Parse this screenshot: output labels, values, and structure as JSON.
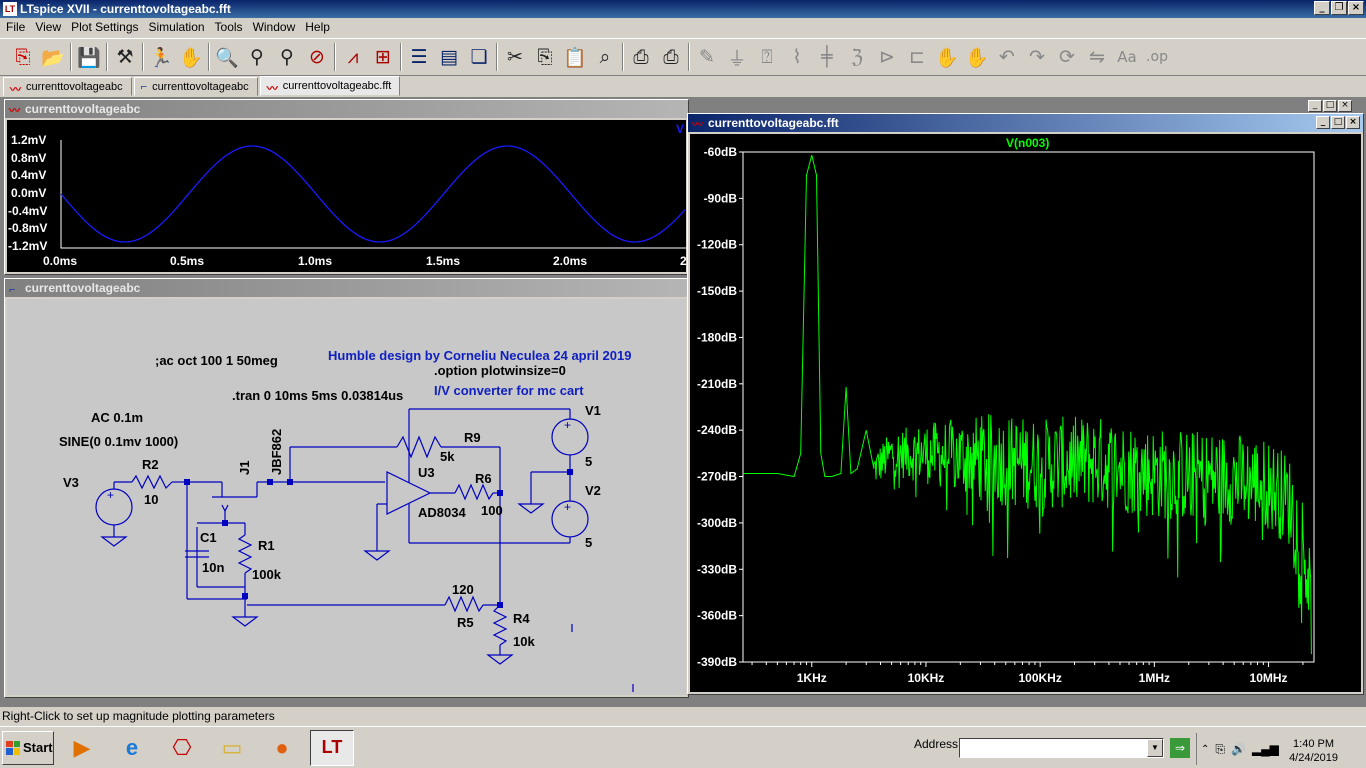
{
  "app": {
    "title": "LTspice XVII - currenttovoltageabc.fft"
  },
  "menu": [
    "File",
    "View",
    "Plot Settings",
    "Simulation",
    "Tools",
    "Window",
    "Help"
  ],
  "toolbar": {
    "icons": [
      "new-schematic-icon",
      "open-icon",
      "save-icon",
      "control-panel-icon",
      "run-icon",
      "halt-icon",
      "zoom-in-icon",
      "zoom-out-icon",
      "zoom-fit-icon",
      "cancel-zoom-icon",
      "autorange-icon",
      "grid-icon",
      "tile-horizontal-icon",
      "tile-vertical-icon",
      "cascade-icon",
      "cut-icon",
      "copy-icon",
      "paste-icon",
      "find-icon",
      "print-icon",
      "print-setup-icon",
      "wire-icon",
      "ground-icon",
      "label-icon",
      "resistor-icon",
      "capacitor-icon",
      "inductor-icon",
      "diode-icon",
      "component-icon",
      "move-icon",
      "drag-icon",
      "undo-icon",
      "redo-icon",
      "rotate-icon",
      "mirror-icon",
      "text-icon",
      "spice-directive-icon"
    ]
  },
  "tabs": [
    {
      "label": "currenttovoltageabc",
      "icon": "waveform-icon"
    },
    {
      "label": "currenttovoltageabc",
      "icon": "schematic-icon"
    },
    {
      "label": "currenttovoltageabc.fft",
      "icon": "waveform-icon"
    }
  ],
  "waveform_window": {
    "title": "currenttovoltageabc",
    "trace_label_partial": "V",
    "y_ticks": [
      "1.2mV",
      "0.8mV",
      "0.4mV",
      "0.0mV",
      "-0.4mV",
      "-0.8mV",
      "-1.2mV"
    ],
    "x_ticks": [
      "0.0ms",
      "0.5ms",
      "1.0ms",
      "1.5ms",
      "2.0ms",
      "2"
    ]
  },
  "schematic_window": {
    "title": "currenttovoltageabc",
    "texts": {
      "ac_directive": ";ac oct 100 1 50meg",
      "credit": "Humble design by Corneliu Neculea 24 april 2019",
      "option": ".option plotwinsize=0",
      "tran": ".tran 0 10ms 5ms 0.03814us",
      "subtitle": "I/V converter for mc cart",
      "ac_value": "AC 0.1m",
      "sine": "SINE(0 0.1mv 1000)",
      "v3": "V3",
      "r2": "R2",
      "r2_val": "10",
      "j1": "J1",
      "jbf": "JBF862",
      "c1": "C1",
      "c1_val": "10n",
      "r1": "R1",
      "r1_val": "100k",
      "r9": "R9",
      "r9_val": "5k",
      "u3": "U3",
      "u3_part": "AD8034",
      "r6": "R6",
      "r6_val": "100",
      "v1": "V1",
      "v1_val": "5",
      "v2": "V2",
      "v2_val": "5",
      "r5_val": "120",
      "r5": "R5",
      "r4": "R4",
      "r4_val": "10k"
    }
  },
  "fft_window": {
    "title": "currenttovoltageabc.fft",
    "trace": "V(n003)",
    "trace_color": "#00ff00"
  },
  "chart_data": {
    "type": "line",
    "title": "V(n003)",
    "xscale": "log",
    "x_ticks": [
      "1KHz",
      "10KHz",
      "100KHz",
      "1MHz",
      "10MHz"
    ],
    "y_ticks": [
      "-60dB",
      "-90dB",
      "-120dB",
      "-150dB",
      "-180dB",
      "-210dB",
      "-240dB",
      "-270dB",
      "-300dB",
      "-330dB",
      "-360dB",
      "-390dB"
    ],
    "xlim": [
      250,
      25000000
    ],
    "ylim": [
      -390,
      -60
    ],
    "grid": false,
    "series": [
      {
        "name": "V(n003)",
        "color": "#00ff00",
        "x": [
          250,
          500,
          700,
          800,
          900,
          1000,
          1100,
          1200,
          1300,
          1500,
          1800,
          2000,
          2200,
          2500,
          3000,
          3500,
          5000,
          10000,
          30000,
          100000,
          300000,
          1000000,
          3000000,
          6000000,
          10000000,
          15000000,
          20000000,
          24000000
        ],
        "y": [
          -268,
          -268,
          -270,
          -255,
          -75,
          -62,
          -75,
          -255,
          -270,
          -270,
          -268,
          -212,
          -268,
          -265,
          -240,
          -265,
          -255,
          -255,
          -258,
          -262,
          -260,
          -268,
          -270,
          -272,
          -275,
          -285,
          -310,
          -360
        ]
      }
    ]
  },
  "statusbar": {
    "text": "Right-Click to set up magnitude plotting parameters"
  },
  "taskbar": {
    "start": "Start",
    "address_label": "Address",
    "address_value": "",
    "time": "1:40 PM",
    "date": "4/24/2019",
    "quicklaunch": [
      "media-player-icon",
      "internet-explorer-icon",
      "acrobat-icon",
      "folder-icon",
      "firefox-icon",
      "ltspice-icon"
    ]
  },
  "colors": {
    "waveform_trace": "#1a1aff",
    "schematic_wire": "#0000c0",
    "schematic_text_blue": "#1020c0"
  }
}
